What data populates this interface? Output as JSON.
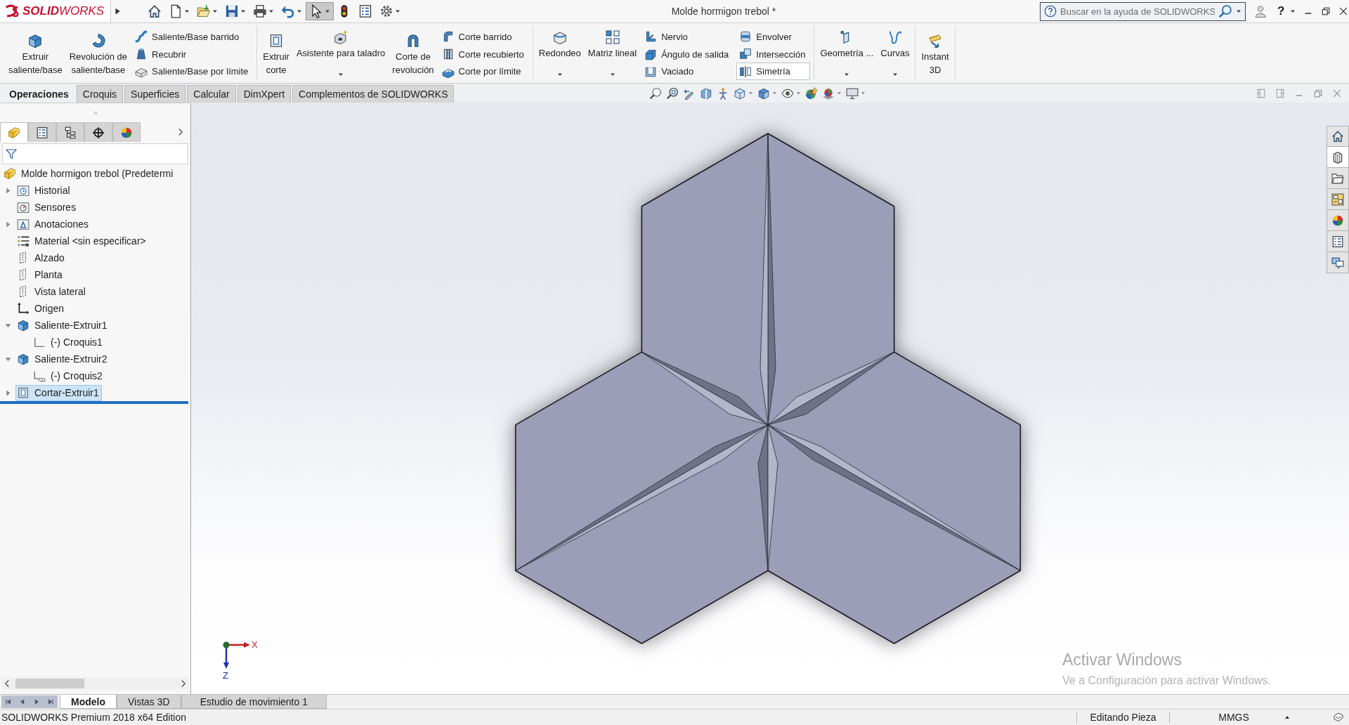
{
  "title_bar": {
    "logo": "**SOLID**WORKS",
    "quick_access": [
      {
        "pressed": false
      },
      {
        "pressed": false
      },
      {
        "pressed": false
      },
      {
        "pressed": false
      },
      {
        "pressed": false
      },
      {
        "pressed": false
      },
      {
        "pressed": true
      },
      {
        "pressed": false
      },
      {
        "pressed": false
      },
      {
        "pressed": false
      }
    ],
    "document_title": "Molde hormigon trebol *",
    "search": {
      "placeholder": "Buscar en la ayuda de SOLIDWORKS"
    },
    "help": "?"
  },
  "ribbon": {
    "sections": [
      {
        "tools": [
          {
            "kind": "large",
            "lines": [
              "Extruir",
              "saliente/base"
            ],
            "dropdown": false
          },
          {
            "kind": "large",
            "lines": [
              "Revolución de",
              "saliente/base"
            ],
            "dropdown": false
          },
          {
            "kind": "stack",
            "buttons": [
              {
                "label": "Saliente/Base barrido",
                "hovered": false
              },
              {
                "label": "Recubrir",
                "hovered": false
              },
              {
                "label": "Saliente/Base por límite",
                "hovered": false
              }
            ]
          }
        ]
      },
      {
        "tools": [
          {
            "kind": "large",
            "lines": [
              "Extruir",
              "corte"
            ],
            "dropdown": false
          },
          {
            "kind": "large",
            "lines": [
              "Asistente para taladro"
            ],
            "dropdown": true
          },
          {
            "kind": "large",
            "lines": [
              "Corte de",
              "revolución"
            ],
            "dropdown": false
          },
          {
            "kind": "stack",
            "buttons": [
              {
                "label": "Corte barrido",
                "hovered": false
              },
              {
                "label": "Corte recubierto",
                "hovered": false
              },
              {
                "label": "Corte por límite",
                "hovered": false
              }
            ]
          }
        ]
      },
      {
        "tools": [
          {
            "kind": "large",
            "lines": [
              "Redondeo"
            ],
            "dropdown": true
          },
          {
            "kind": "large",
            "lines": [
              "Matriz lineal"
            ],
            "dropdown": true
          },
          {
            "kind": "stack",
            "buttons": [
              {
                "label": "Nervio",
                "hovered": false
              },
              {
                "label": "Ángulo de salida",
                "hovered": false
              },
              {
                "label": "Vaciado",
                "hovered": false
              }
            ]
          },
          {
            "kind": "stack",
            "buttons": [
              {
                "label": "Envolver",
                "hovered": false
              },
              {
                "label": "Intersección",
                "hovered": false
              },
              {
                "label": "Simetría",
                "hovered": true
              }
            ]
          }
        ]
      },
      {
        "tools": [
          {
            "kind": "large",
            "lines": [
              "Geometría ..."
            ],
            "dropdown": true
          },
          {
            "kind": "large",
            "lines": [
              "Curvas"
            ],
            "dropdown": true
          }
        ]
      },
      {
        "tools": [
          {
            "kind": "large",
            "lines": [
              "Instant",
              "3D"
            ],
            "dropdown": false
          }
        ]
      }
    ]
  },
  "command_tabs": [
    {
      "label": "Operaciones",
      "selected": true
    },
    {
      "label": "Croquis",
      "selected": false
    },
    {
      "label": "Superficies",
      "selected": false
    },
    {
      "label": "Calcular",
      "selected": false
    },
    {
      "label": "DimXpert",
      "selected": false
    },
    {
      "label": "Complementos de SOLIDWORKS",
      "selected": false
    }
  ],
  "feature_manager": {
    "tabs": [
      {
        "selected": true
      },
      {
        "selected": false
      },
      {
        "selected": false
      },
      {
        "selected": false
      },
      {
        "selected": false
      }
    ],
    "tree": [
      {
        "kind": "part",
        "label": "Molde hormigon trebol (Predetermi",
        "selected": false,
        "children": [
          {
            "kind": "history",
            "label": "Historial",
            "expanded": false,
            "selected": false
          },
          {
            "kind": "sensors",
            "label": "Sensores",
            "selected": false
          },
          {
            "kind": "annotations",
            "label": "Anotaciones",
            "expanded": false,
            "selected": false
          },
          {
            "kind": "material",
            "label": "Material <sin especificar>",
            "selected": false
          },
          {
            "kind": "plane",
            "label": "Alzado",
            "selected": false
          },
          {
            "kind": "plane",
            "label": "Planta",
            "selected": false
          },
          {
            "kind": "plane",
            "label": "Vista lateral",
            "selected": false
          },
          {
            "kind": "origin",
            "label": "Origen",
            "selected": false
          },
          {
            "kind": "boss",
            "label": "Saliente-Extruir1",
            "expanded": true,
            "selected": false,
            "children": [
              {
                "kind": "sketch",
                "label": "(-) Croquis1",
                "selected": false
              }
            ]
          },
          {
            "kind": "boss",
            "label": "Saliente-Extruir2",
            "expanded": true,
            "selected": false,
            "children": [
              {
                "kind": "shared-sketch",
                "label": "(-) Croquis2",
                "selected": false
              }
            ]
          },
          {
            "kind": "cut",
            "label": "Cortar-Extruir1",
            "expanded": false,
            "selected": true
          }
        ]
      }
    ]
  },
  "viewport": {
    "triad": {
      "x_label": "X",
      "z_label": "Z"
    },
    "task_pane": [
      {
        "selected": false
      },
      {
        "selected": true
      },
      {
        "selected": false
      },
      {
        "selected": false
      },
      {
        "selected": false
      },
      {
        "selected": false
      },
      {
        "selected": false
      }
    ],
    "activation_notice": {
      "title": "Activar Windows",
      "text": "Ve a Configuración para activar Windows."
    }
  },
  "bottom_tabs": [
    {
      "label": "Modelo",
      "selected": true
    },
    {
      "label": "Vistas 3D",
      "selected": false
    },
    {
      "label": "Estudio de movimiento 1",
      "selected": false
    }
  ],
  "status_bar": {
    "product": "SOLIDWORKS Premium 2018 x64 Edition",
    "mode": "Editando Pieza",
    "units": "MMGS"
  }
}
